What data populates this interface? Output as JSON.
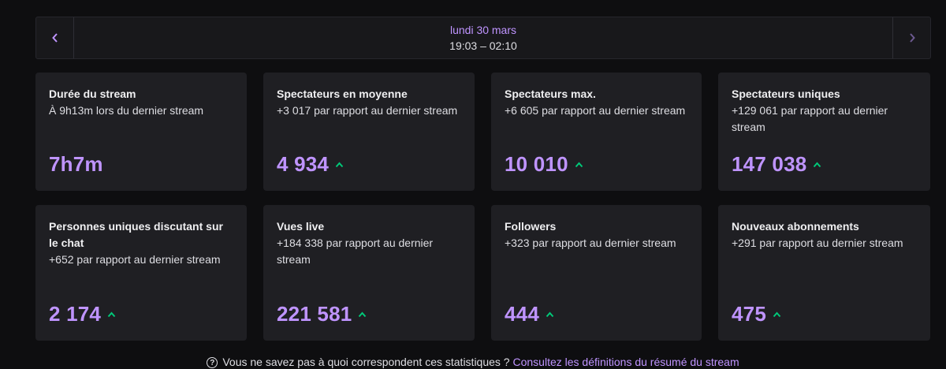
{
  "date_nav": {
    "date": "lundi 30 mars",
    "time_range": "19:03 – 02:10",
    "prev_icon": "chevron-left-icon",
    "next_icon": "chevron-right-icon"
  },
  "colors": {
    "accent": "#bf94ff",
    "up": "#00c979",
    "card_bg": "#1f1f23",
    "page_bg": "#0e0e10"
  },
  "stats": [
    {
      "title": "Durée du stream",
      "desc": "À 9h13m lors du dernier stream",
      "value": "7h7m",
      "trend": "none"
    },
    {
      "title": "Spectateurs en moyenne",
      "desc": "+3 017 par rapport au dernier stream",
      "value": "4 934",
      "trend": "up"
    },
    {
      "title": "Spectateurs max.",
      "desc": "+6 605 par rapport au dernier stream",
      "value": "10 010",
      "trend": "up"
    },
    {
      "title": "Spectateurs uniques",
      "desc": "+129 061 par rapport au dernier stream",
      "value": "147 038",
      "trend": "up"
    },
    {
      "title": "Personnes uniques discutant sur le chat",
      "desc": "+652 par rapport au dernier stream",
      "value": "2 174",
      "trend": "up"
    },
    {
      "title": "Vues live",
      "desc": "+184 338 par rapport au dernier stream",
      "value": "221 581",
      "trend": "up"
    },
    {
      "title": "Followers",
      "desc": "+323 par rapport au dernier stream",
      "value": "444",
      "trend": "up"
    },
    {
      "title": "Nouveaux abonnements",
      "desc": "+291 par rapport au dernier stream",
      "value": "475",
      "trend": "up"
    }
  ],
  "footer": {
    "question": "Vous ne savez pas à quoi correspondent ces statistiques ?",
    "link": "Consultez les définitions du résumé du stream"
  }
}
